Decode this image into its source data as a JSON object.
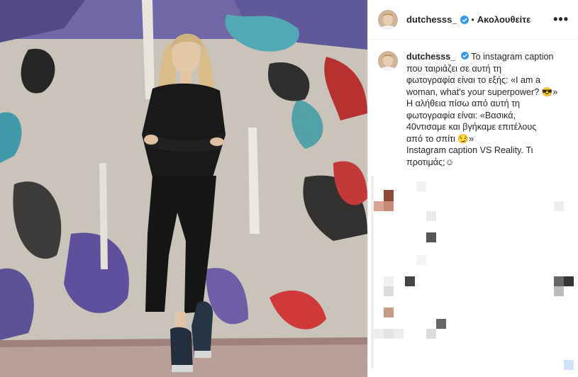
{
  "post": {
    "username": "dutchesss_",
    "separator": "•",
    "follow_status": "Ακολουθείτε",
    "more_label": "•••",
    "caption": {
      "username": "dutchesss_",
      "lines": [
        "Το instagram caption",
        "που ταιριάζει σε αυτή τη",
        "φωτογραφία είναι το εξής: «I am a",
        "woman, what's your superpower? 😎»",
        "Η αλήθεια πίσω από αυτή τη",
        "φωτογραφία είναι: «Βασικά,",
        "40ντισαμε και βγήκαμε επιτέλους",
        "από το σπίτι 😏»",
        "Instagram caption VS Reality. Τι",
        "προτιμάς;☺"
      ]
    }
  },
  "colors": {
    "verified": "#3897f0",
    "text": "#262626",
    "border": "#efefef"
  },
  "icons": {
    "verified": "verified-badge-icon",
    "more": "more-options-icon"
  }
}
